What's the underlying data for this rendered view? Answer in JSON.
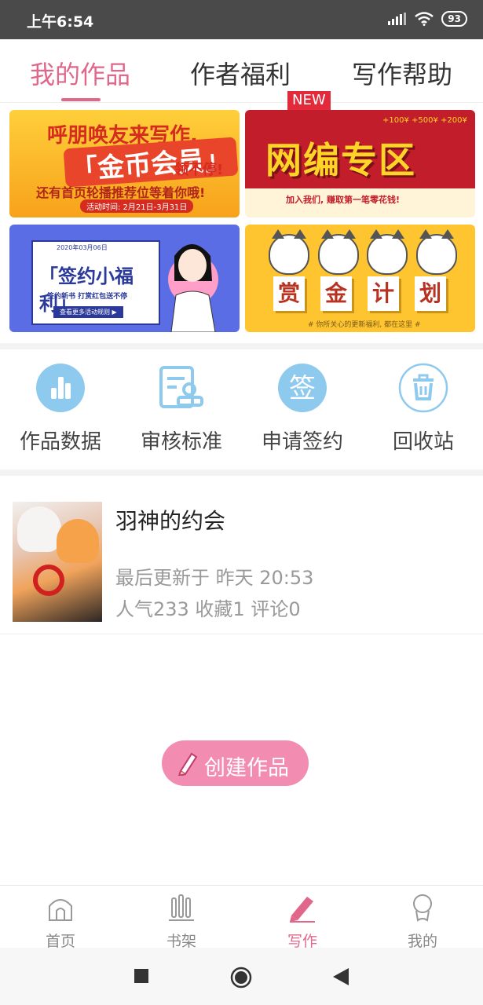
{
  "status_bar": {
    "time": "上午6:54",
    "battery": "93"
  },
  "tabs": [
    {
      "label": "我的作品",
      "active": true
    },
    {
      "label": "作者福利",
      "badge": "NEW"
    },
    {
      "label": "写作帮助"
    }
  ],
  "banners": {
    "b1": {
      "line1": "呼朋唤友来写作,",
      "line2": "「金币会员」",
      "line2b": "领不停!",
      "line3": "还有首页轮播推荐位等着你哦!",
      "line4": "活动时间: 2月21日-3月31日"
    },
    "b2": {
      "stars": "+100¥ +500¥ +200¥",
      "title": "网编专区",
      "sub": "加入我们, 赚取第一笔零花钱!"
    },
    "b3": {
      "date": "2020年03月06日",
      "title": "「签约小福利」",
      "sub": "签约新书  打赏红包送不停",
      "button": "查看更多活动规则 ▶"
    },
    "b4": {
      "chars": [
        "赏",
        "金",
        "计",
        "划"
      ],
      "foot": "# 你所关心的更新福利, 都在这里 #"
    }
  },
  "actions": [
    {
      "label": "作品数据",
      "icon": "bar-chart-icon"
    },
    {
      "label": "审核标准",
      "icon": "document-stamp-icon"
    },
    {
      "label": "申请签约",
      "icon": "sign-icon",
      "icon_text": "签"
    },
    {
      "label": "回收站",
      "icon": "trash-icon"
    }
  ],
  "work": {
    "title": "羽神的约会",
    "updated": "最后更新于 昨天 20:53",
    "stats": "人气233 收藏1 评论0"
  },
  "create_button": "创建作品",
  "bottom_nav": [
    {
      "label": "首页",
      "icon": "home-icon"
    },
    {
      "label": "书架",
      "icon": "bookshelf-icon"
    },
    {
      "label": "写作",
      "icon": "pencil-icon",
      "active": true
    },
    {
      "label": "我的",
      "icon": "profile-icon"
    }
  ],
  "colors": {
    "accent": "#e0678a",
    "create_button": "#f28cb0",
    "action_icon": "#8ec9ee"
  }
}
